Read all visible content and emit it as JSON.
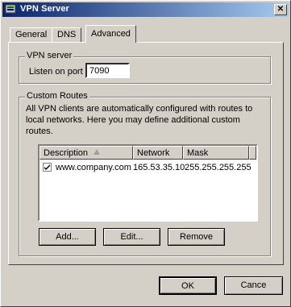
{
  "window": {
    "title": "VPN Server",
    "close_glyph": "✕"
  },
  "tabs": [
    {
      "label": "General"
    },
    {
      "label": "DNS"
    },
    {
      "label": "Advanced",
      "active": true
    }
  ],
  "vpn_server": {
    "legend": "VPN server",
    "port_label": "Listen on port",
    "port_value": "7090"
  },
  "custom_routes": {
    "legend": "Custom Routes",
    "description": "All VPN clients are automatically configured with routes to local networks. Here you may define additional custom routes.",
    "columns": [
      "Description",
      "Network",
      "Mask"
    ],
    "rows": [
      {
        "checked": true,
        "description": "www.company.com",
        "network": "165.53.35.10",
        "mask": "255.255.255.255"
      }
    ],
    "buttons": {
      "add": "Add...",
      "edit": "Edit...",
      "remove": "Remove"
    }
  },
  "footer": {
    "ok": "OK",
    "cancel": "Cance"
  },
  "icons": {
    "title": "vpn-server-icon",
    "close": "close-icon",
    "sort": "sort-ascending-icon",
    "check": "checkmark-icon"
  }
}
